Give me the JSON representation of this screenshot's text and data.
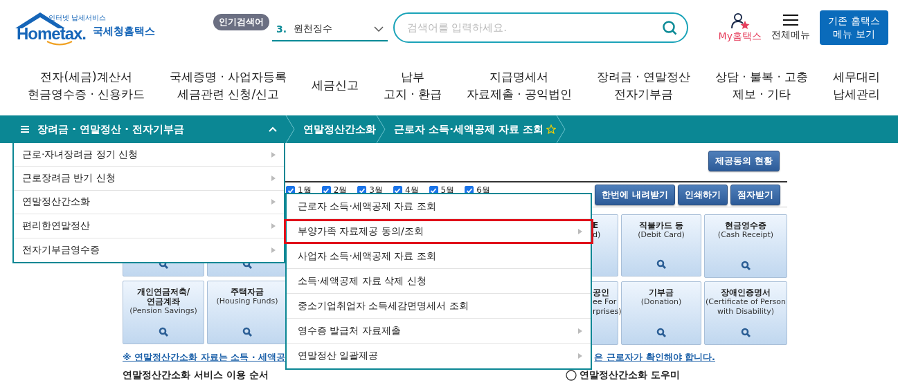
{
  "header": {
    "logo": {
      "tagline": "인터넷 납세서비스",
      "wordmark": "Hometax.",
      "name": "국세청홈택스"
    },
    "popular_badge": "인기검색어",
    "popular_select": {
      "rank": "3.",
      "value": "원천징수"
    },
    "search": {
      "placeholder": "검색어를 입력하세요."
    },
    "my_hometax": "My홈택스",
    "all_menu": "전체메뉴",
    "legacy_button": [
      "기존 홈택스",
      "메뉴 보기"
    ]
  },
  "nav": [
    {
      "lines": [
        "전자(세금)계산서",
        "현금영수증 · 신용카드"
      ]
    },
    {
      "lines": [
        "국세증명 · 사업자등록",
        "세금관련 신청/신고"
      ]
    },
    {
      "lines": [
        "세금신고"
      ]
    },
    {
      "lines": [
        "납부",
        "고지 · 환급"
      ]
    },
    {
      "lines": [
        "지급명세서",
        "자료제출 · 공익법인"
      ]
    },
    {
      "lines": [
        "장려금 · 연말정산",
        "전자기부금"
      ]
    },
    {
      "lines": [
        "상담 · 불복 · 고충",
        "제보 · 기타"
      ]
    },
    {
      "lines": [
        "세무대리",
        "납세관리"
      ]
    }
  ],
  "breadcrumb": {
    "menu_title": "장려금 · 연말정산 · 전자기부금",
    "expanded": true,
    "items": [
      {
        "label": "연말정산간소화",
        "favorite": false
      },
      {
        "label": "근로자 소득·세액공제 자료 조회",
        "favorite": false
      }
    ]
  },
  "consent_button": "제공동의 현황",
  "months": [
    {
      "label": "1월",
      "checked": true
    },
    {
      "label": "2월",
      "checked": true
    },
    {
      "label": "3월",
      "checked": true
    },
    {
      "label": "4월",
      "checked": true
    },
    {
      "label": "5월",
      "checked": true
    },
    {
      "label": "6월",
      "checked": true
    }
  ],
  "toolbar_buttons": [
    "한번에 내려받기",
    "인쇄하기",
    "점자받기"
  ],
  "tiles_left": [
    {
      "kind": "icon_only"
    },
    {
      "kind": "icon_only"
    },
    {
      "kind": "full",
      "title": "개인연금저축/\n연금계좌",
      "subtitle": "(Pension Savings)"
    },
    {
      "kind": "full",
      "title": "주택자금",
      "subtitle": "(Housing Funds)"
    }
  ],
  "tiles_right": [
    {
      "kind": "partial",
      "lines": [
        {
          "text": "E",
          "bold": true
        },
        {
          "text": "d)",
          "bold": false
        }
      ]
    },
    {
      "kind": "full",
      "title": "직불카드 등",
      "subtitle": "(Debit Card)"
    },
    {
      "kind": "full",
      "title": "현금영수증",
      "subtitle": "(Cash Receipt)"
    },
    {
      "kind": "partial",
      "lines": [
        {
          "text": "공인",
          "bold": true
        },
        {
          "text": "ee For",
          "bold": false
        },
        {
          "text": "rprises)",
          "bold": false
        }
      ]
    },
    {
      "kind": "full",
      "title": "기부금",
      "subtitle": "(Donation)"
    },
    {
      "kind": "full",
      "title": "장애인증명서",
      "subtitle": "(Certificate of Person with Disability)"
    }
  ],
  "notice": [
    "※ 연말정산간소화 자료는 소득 · 세액공",
    "은 근로자가 확인해야 합니다."
  ],
  "bottom": {
    "heading": "연말정산간소화 서비스 이용 순서",
    "helper": "연말정산간소화 도우미"
  },
  "side_menu": [
    {
      "label": "근로·자녀장려금 정기 신청",
      "has_submenu": true
    },
    {
      "label": "근로장려금 반기 신청",
      "has_submenu": true
    },
    {
      "label": "연말정산간소화",
      "has_submenu": true
    },
    {
      "label": "편리한연말정산",
      "has_submenu": true
    },
    {
      "label": "전자기부금영수증",
      "has_submenu": true
    }
  ],
  "submenu": [
    {
      "label": "근로자 소득·세액공제 자료 조회",
      "has_submenu": false,
      "highlighted": false
    },
    {
      "label": "부양가족 자료제공 동의/조회",
      "has_submenu": true,
      "highlighted": true
    },
    {
      "label": "사업자 소득·세액공제 자료 조회",
      "has_submenu": false,
      "highlighted": false
    },
    {
      "label": "소득·세액공제 자료 삭제 신청",
      "has_submenu": false,
      "highlighted": false
    },
    {
      "label": "중소기업취업자 소득세감면명세서 조회",
      "has_submenu": false,
      "highlighted": false
    },
    {
      "label": "영수증 발급처 자료제출",
      "has_submenu": true,
      "highlighted": false
    },
    {
      "label": "연말정산 일괄제공",
      "has_submenu": true,
      "highlighted": false
    }
  ]
}
